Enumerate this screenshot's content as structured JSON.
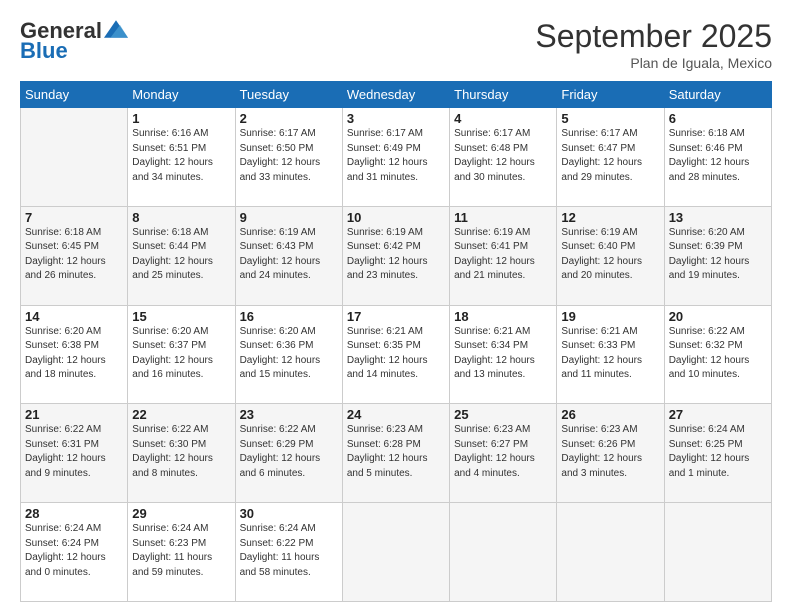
{
  "logo": {
    "general": "General",
    "blue": "Blue"
  },
  "title": "September 2025",
  "location": "Plan de Iguala, Mexico",
  "days_of_week": [
    "Sunday",
    "Monday",
    "Tuesday",
    "Wednesday",
    "Thursday",
    "Friday",
    "Saturday"
  ],
  "weeks": [
    [
      {
        "day": "",
        "info": ""
      },
      {
        "day": "1",
        "info": "Sunrise: 6:16 AM\nSunset: 6:51 PM\nDaylight: 12 hours\nand 34 minutes."
      },
      {
        "day": "2",
        "info": "Sunrise: 6:17 AM\nSunset: 6:50 PM\nDaylight: 12 hours\nand 33 minutes."
      },
      {
        "day": "3",
        "info": "Sunrise: 6:17 AM\nSunset: 6:49 PM\nDaylight: 12 hours\nand 31 minutes."
      },
      {
        "day": "4",
        "info": "Sunrise: 6:17 AM\nSunset: 6:48 PM\nDaylight: 12 hours\nand 30 minutes."
      },
      {
        "day": "5",
        "info": "Sunrise: 6:17 AM\nSunset: 6:47 PM\nDaylight: 12 hours\nand 29 minutes."
      },
      {
        "day": "6",
        "info": "Sunrise: 6:18 AM\nSunset: 6:46 PM\nDaylight: 12 hours\nand 28 minutes."
      }
    ],
    [
      {
        "day": "7",
        "info": "Sunrise: 6:18 AM\nSunset: 6:45 PM\nDaylight: 12 hours\nand 26 minutes."
      },
      {
        "day": "8",
        "info": "Sunrise: 6:18 AM\nSunset: 6:44 PM\nDaylight: 12 hours\nand 25 minutes."
      },
      {
        "day": "9",
        "info": "Sunrise: 6:19 AM\nSunset: 6:43 PM\nDaylight: 12 hours\nand 24 minutes."
      },
      {
        "day": "10",
        "info": "Sunrise: 6:19 AM\nSunset: 6:42 PM\nDaylight: 12 hours\nand 23 minutes."
      },
      {
        "day": "11",
        "info": "Sunrise: 6:19 AM\nSunset: 6:41 PM\nDaylight: 12 hours\nand 21 minutes."
      },
      {
        "day": "12",
        "info": "Sunrise: 6:19 AM\nSunset: 6:40 PM\nDaylight: 12 hours\nand 20 minutes."
      },
      {
        "day": "13",
        "info": "Sunrise: 6:20 AM\nSunset: 6:39 PM\nDaylight: 12 hours\nand 19 minutes."
      }
    ],
    [
      {
        "day": "14",
        "info": "Sunrise: 6:20 AM\nSunset: 6:38 PM\nDaylight: 12 hours\nand 18 minutes."
      },
      {
        "day": "15",
        "info": "Sunrise: 6:20 AM\nSunset: 6:37 PM\nDaylight: 12 hours\nand 16 minutes."
      },
      {
        "day": "16",
        "info": "Sunrise: 6:20 AM\nSunset: 6:36 PM\nDaylight: 12 hours\nand 15 minutes."
      },
      {
        "day": "17",
        "info": "Sunrise: 6:21 AM\nSunset: 6:35 PM\nDaylight: 12 hours\nand 14 minutes."
      },
      {
        "day": "18",
        "info": "Sunrise: 6:21 AM\nSunset: 6:34 PM\nDaylight: 12 hours\nand 13 minutes."
      },
      {
        "day": "19",
        "info": "Sunrise: 6:21 AM\nSunset: 6:33 PM\nDaylight: 12 hours\nand 11 minutes."
      },
      {
        "day": "20",
        "info": "Sunrise: 6:22 AM\nSunset: 6:32 PM\nDaylight: 12 hours\nand 10 minutes."
      }
    ],
    [
      {
        "day": "21",
        "info": "Sunrise: 6:22 AM\nSunset: 6:31 PM\nDaylight: 12 hours\nand 9 minutes."
      },
      {
        "day": "22",
        "info": "Sunrise: 6:22 AM\nSunset: 6:30 PM\nDaylight: 12 hours\nand 8 minutes."
      },
      {
        "day": "23",
        "info": "Sunrise: 6:22 AM\nSunset: 6:29 PM\nDaylight: 12 hours\nand 6 minutes."
      },
      {
        "day": "24",
        "info": "Sunrise: 6:23 AM\nSunset: 6:28 PM\nDaylight: 12 hours\nand 5 minutes."
      },
      {
        "day": "25",
        "info": "Sunrise: 6:23 AM\nSunset: 6:27 PM\nDaylight: 12 hours\nand 4 minutes."
      },
      {
        "day": "26",
        "info": "Sunrise: 6:23 AM\nSunset: 6:26 PM\nDaylight: 12 hours\nand 3 minutes."
      },
      {
        "day": "27",
        "info": "Sunrise: 6:24 AM\nSunset: 6:25 PM\nDaylight: 12 hours\nand 1 minute."
      }
    ],
    [
      {
        "day": "28",
        "info": "Sunrise: 6:24 AM\nSunset: 6:24 PM\nDaylight: 12 hours\nand 0 minutes."
      },
      {
        "day": "29",
        "info": "Sunrise: 6:24 AM\nSunset: 6:23 PM\nDaylight: 11 hours\nand 59 minutes."
      },
      {
        "day": "30",
        "info": "Sunrise: 6:24 AM\nSunset: 6:22 PM\nDaylight: 11 hours\nand 58 minutes."
      },
      {
        "day": "",
        "info": ""
      },
      {
        "day": "",
        "info": ""
      },
      {
        "day": "",
        "info": ""
      },
      {
        "day": "",
        "info": ""
      }
    ]
  ]
}
